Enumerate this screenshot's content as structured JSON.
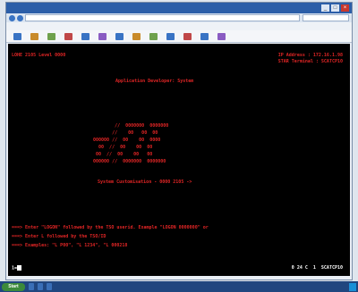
{
  "window": {
    "title": "",
    "url": ""
  },
  "menu": {
    "items": [
      "",
      "",
      "",
      "",
      ""
    ]
  },
  "toolbar": {
    "icons": [
      "back-icon",
      "forward-icon",
      "refresh-icon",
      "home-icon",
      "print-icon",
      "font-icon",
      "color-icon",
      "copy-icon",
      "paste-icon",
      "keyboard-icon",
      "settings-icon",
      "help-icon",
      "macro-icon"
    ],
    "icon_colors": [
      "#3a74c4",
      "#c98b2a",
      "#6fa14c",
      "#c04848",
      "#3a74c4",
      "#8a5cc2",
      "#3a74c4",
      "#c98b2a",
      "#6fa14c",
      "#3a74c4",
      "#c04848",
      "#3a74c4",
      "#8a5cc2"
    ]
  },
  "terminal": {
    "header_left": "LOHE 2105 Level 0000",
    "ip_address": "IP Address : 172.16.1.98",
    "terminal_id": "STAR Terminal : SCATCP10",
    "app_title": "Application Developer: System",
    "logo": "        //  0000000  0000000\n       //    00   00  00\n000000 //  00    00  0000\n  00  //  00    00  00\n 00  //  00    00   00\n000000 //  0000000  0000000",
    "system_customization": "System Customisation - 0000 2105 ->",
    "message_line1": "===> Enter \"LOGON\" followed by the TSO userid. Example \"LOGON 0000000\" or",
    "message_line2": "===> Enter L followed by the TSO/ID",
    "message_line3": "===> Examples: \"L P00\", \"L 1234\", \"L 000218",
    "cursor_prompt": "1=",
    "status_right": "0 24 C  1  SCATCP10"
  },
  "taskbar": {
    "start_label": "Start",
    "items": [
      "",
      "",
      ""
    ],
    "clock": ""
  },
  "colors": {
    "terminal_bg": "#000000",
    "terminal_text": "#e02525",
    "titlebar": "#2b5ea8"
  }
}
